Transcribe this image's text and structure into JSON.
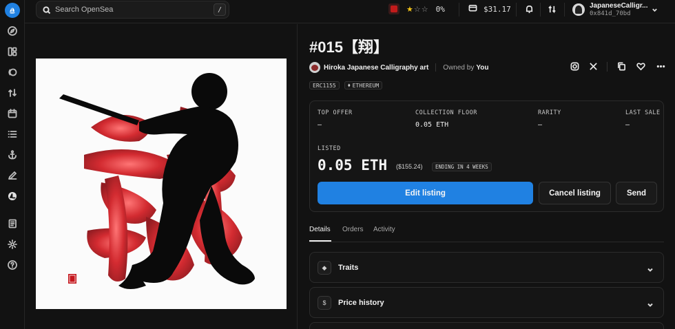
{
  "search": {
    "placeholder": "Search OpenSea",
    "shortcut": "/"
  },
  "topbar": {
    "rating_stars": "★☆☆",
    "rating_percent": "0%",
    "balance": "$31.17",
    "account_name": "JapaneseCalligr...",
    "account_address": "0x841d_70bd"
  },
  "sidebar": {
    "items": [
      "compass-icon",
      "grid-icon",
      "toggle-icon",
      "swap-icon",
      "calendar-icon",
      "list-icon",
      "anchor-icon",
      "pen-icon",
      "opensea-icon",
      "book-icon",
      "gear-icon",
      "help-icon"
    ]
  },
  "item": {
    "title": "#015【翔】",
    "creator": "Hiroka Japanese Calligraphy art",
    "owned_label": "Owned by",
    "owned_by": "You",
    "chips": [
      "ERC1155",
      "ETHEREUM"
    ],
    "stats": [
      {
        "label": "TOP OFFER",
        "value": "–"
      },
      {
        "label": "COLLECTION FLOOR",
        "value": "0.05 ETH"
      },
      {
        "label": "RARITY",
        "value": "–"
      },
      {
        "label": "LAST SALE",
        "value": "–"
      }
    ],
    "listed_label": "LISTED",
    "listed_price": "0.05 ETH",
    "listed_usd": "($155.24)",
    "ending": "ENDING IN 4 WEEKS",
    "buttons": {
      "edit": "Edit listing",
      "cancel": "Cancel listing",
      "send": "Send"
    },
    "tabs": [
      "Details",
      "Orders",
      "Activity"
    ],
    "sections": [
      {
        "title": "Traits",
        "icon": "◆"
      },
      {
        "title": "Price history",
        "icon": "$"
      }
    ]
  },
  "colors": {
    "accent": "#2081e2",
    "background": "#121212",
    "art_red": "#c4161c"
  }
}
